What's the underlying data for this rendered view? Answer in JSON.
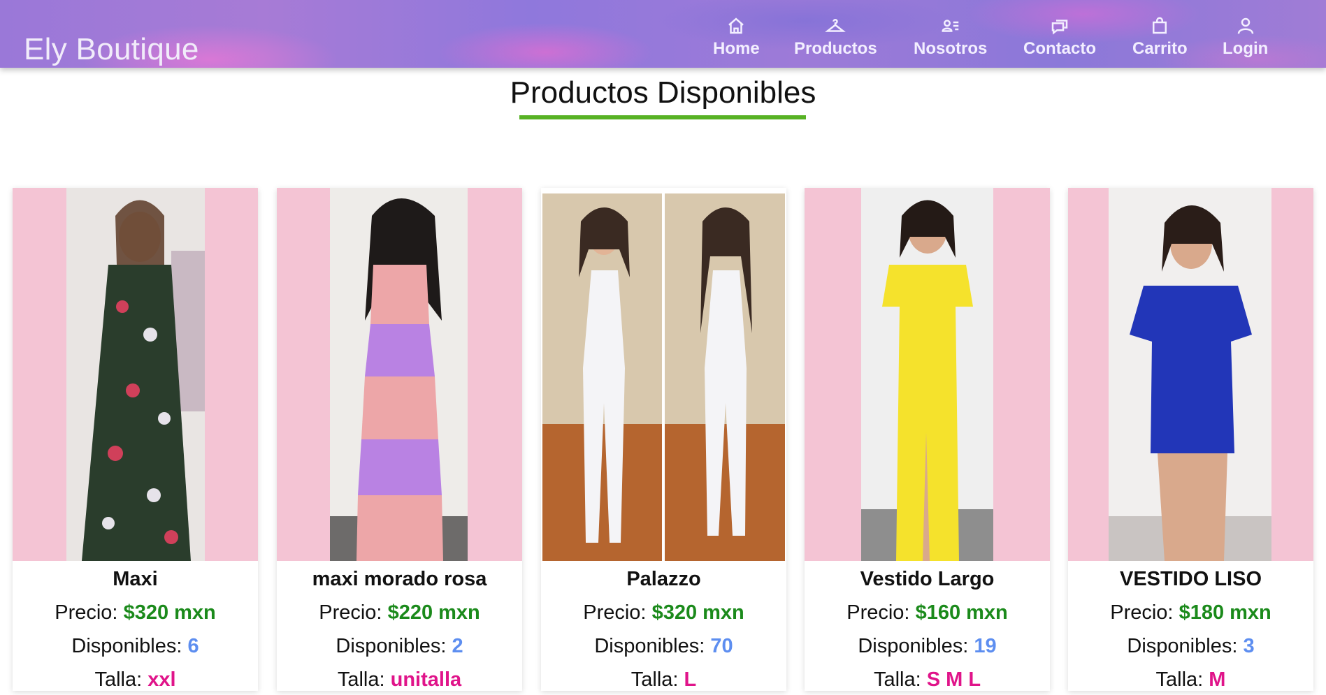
{
  "header": {
    "brand": "Ely Boutique",
    "nav": [
      {
        "label": "Home",
        "icon": "home-icon"
      },
      {
        "label": "Productos",
        "icon": "hanger-icon"
      },
      {
        "label": "Nosotros",
        "icon": "id-card-icon"
      },
      {
        "label": "Contacto",
        "icon": "chat-icon"
      },
      {
        "label": "Carrito",
        "icon": "shopping-bag-icon"
      },
      {
        "label": "Login",
        "icon": "user-icon"
      }
    ]
  },
  "page": {
    "title": "Productos Disponibles",
    "accent_color": "#57b224"
  },
  "labels": {
    "price": "Precio: ",
    "stock": "Disponibles: ",
    "size": "Talla: "
  },
  "products": [
    {
      "name": "Maxi",
      "price": "$320 mxn",
      "stock": "6",
      "size": "xxl",
      "dress_color": "#2a3d2c"
    },
    {
      "name": "maxi morado rosa",
      "price": "$220 mxn",
      "stock": "2",
      "size": "unitalla",
      "dress_color": "#b982e3"
    },
    {
      "name": "Palazzo",
      "price": "$320 mxn",
      "stock": "70",
      "size": "L",
      "dress_color": "#f4f4f7"
    },
    {
      "name": "Vestido Largo",
      "price": "$160 mxn",
      "stock": "19",
      "size": "S M L",
      "dress_color": "#f5e22c"
    },
    {
      "name": "VESTIDO LISO",
      "price": "$180 mxn",
      "stock": "3",
      "size": "M",
      "dress_color": "#2236b8"
    }
  ],
  "colors": {
    "card_background": "#f4c4d4",
    "price": "#1b8a1b",
    "stock": "#5d8ef0",
    "size": "#e0148a"
  }
}
